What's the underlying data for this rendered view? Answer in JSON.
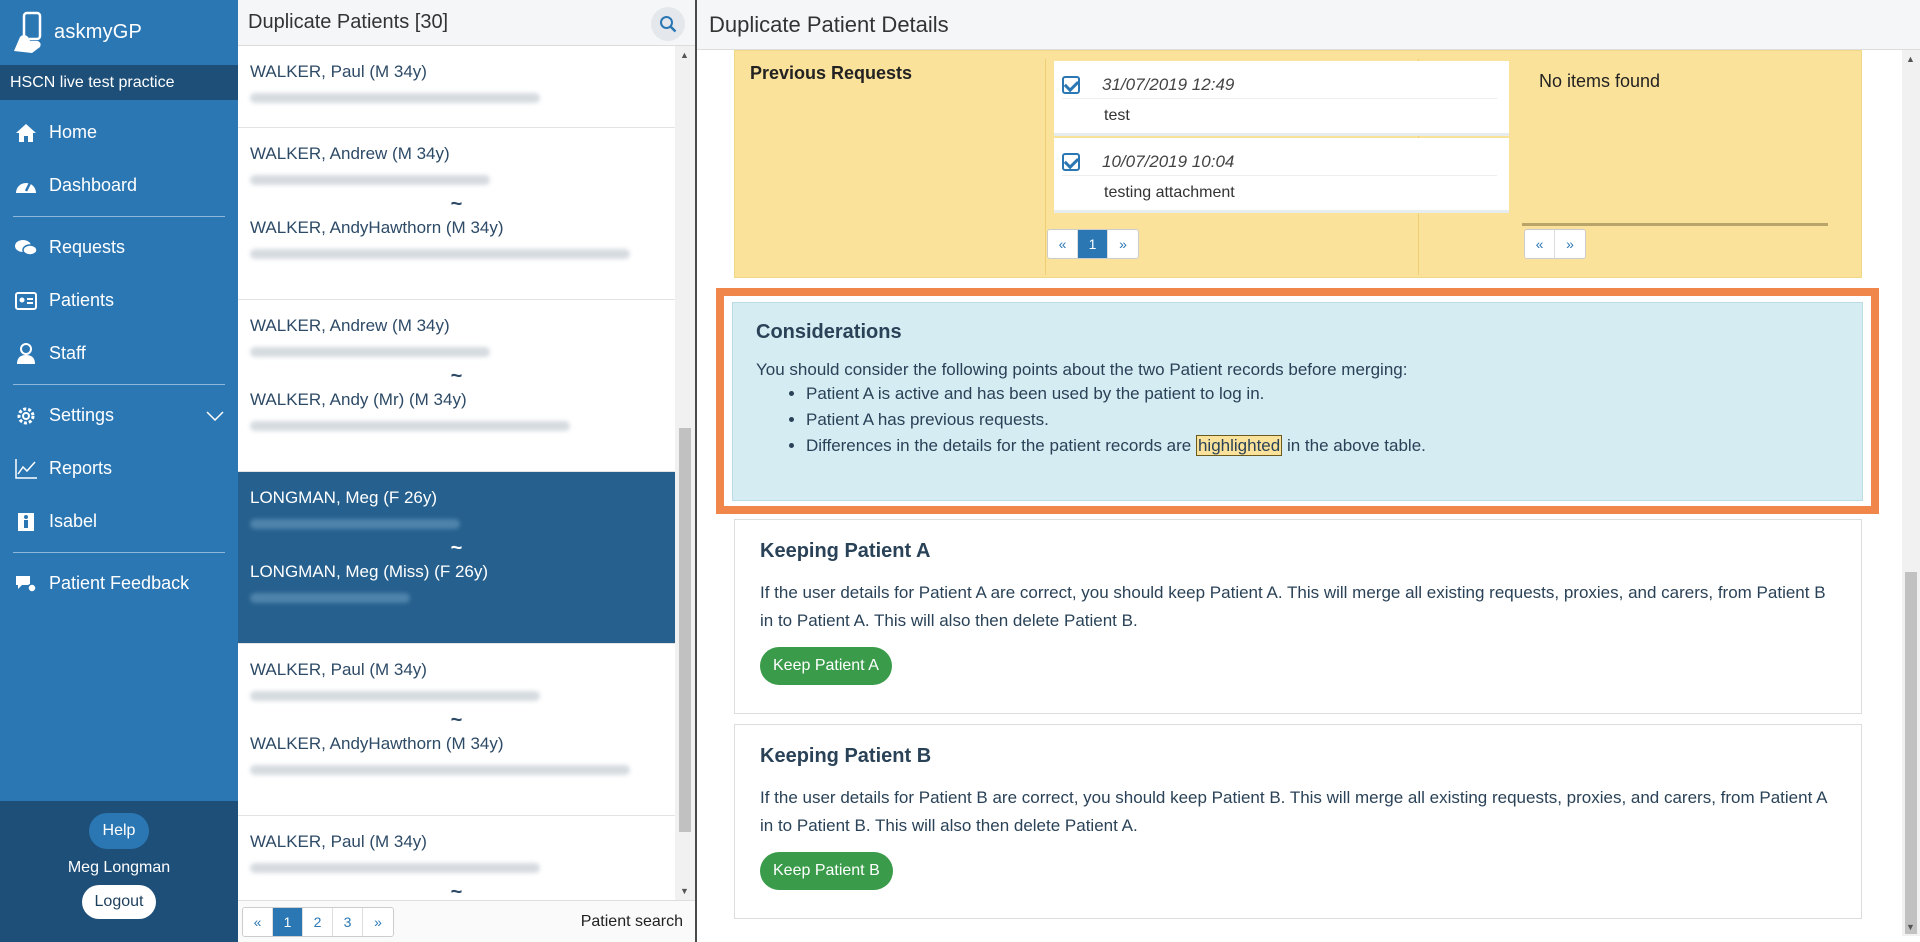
{
  "app": {
    "name": "askmyGP",
    "practice": "HSCN live test practice"
  },
  "nav": [
    {
      "label": "Home",
      "icon": "home-icon"
    },
    {
      "label": "Dashboard",
      "icon": "dashboard-icon"
    },
    {
      "label": "Requests",
      "icon": "chat-icon"
    },
    {
      "label": "Patients",
      "icon": "id-card-icon"
    },
    {
      "label": "Staff",
      "icon": "staff-icon"
    },
    {
      "label": "Settings",
      "icon": "gear-icon"
    },
    {
      "label": "Reports",
      "icon": "chart-icon"
    },
    {
      "label": "Isabel",
      "icon": "info-icon"
    },
    {
      "label": "Patient Feedback",
      "icon": "feedback-icon"
    }
  ],
  "sidebar_footer": {
    "help": "Help",
    "user": "Meg Longman",
    "logout": "Logout"
  },
  "list": {
    "title": "Duplicate Patients [30]",
    "items": [
      {
        "a": "WALKER, Paul (M 34y)"
      },
      {
        "a": "WALKER, Andrew (M 34y)",
        "b": "WALKER, AndyHawthorn (M 34y)"
      },
      {
        "a": "WALKER, Andrew (M 34y)",
        "b": "WALKER, Andy (Mr) (M 34y)"
      },
      {
        "a": "LONGMAN, Meg (F 26y)",
        "b": "LONGMAN, Meg (Miss) (F 26y)"
      },
      {
        "a": "WALKER, Paul (M 34y)",
        "b": "WALKER, AndyHawthorn (M 34y)"
      },
      {
        "a": "WALKER, Paul (M 34y)"
      }
    ],
    "tilde": "~",
    "pagination": [
      "«",
      "1",
      "2",
      "3",
      "»"
    ],
    "patient_search": "Patient search"
  },
  "details": {
    "title": "Duplicate Patient Details",
    "previous_requests": {
      "label": "Previous Requests",
      "items": [
        {
          "date": "31/07/2019 12:49",
          "text": "test"
        },
        {
          "date": "10/07/2019 10:04",
          "text": "testing attachment"
        }
      ],
      "pagination_a": [
        "«",
        "1",
        "»"
      ],
      "no_items": "No items found",
      "pagination_b": [
        "«",
        "»"
      ]
    },
    "considerations": {
      "title": "Considerations",
      "intro": "You should consider the following points about the two Patient records before merging:",
      "points": [
        "Patient A is active and has been used by the patient to log in.",
        "Patient A has previous requests."
      ],
      "diff_before": "Differences in the details for the patient records are ",
      "diff_highlight": "highlighted",
      "diff_after": " in the above table."
    },
    "keep_a": {
      "title": "Keeping Patient A",
      "text": "If the user details for Patient A are correct, you should keep Patient A. This will merge all existing requests, proxies, and carers, from Patient B in to Patient A. This will also then delete Patient B.",
      "button": "Keep Patient A"
    },
    "keep_b": {
      "title": "Keeping Patient B",
      "text": "If the user details for Patient B are correct, you should keep Patient B. This will merge all existing requests, proxies, and carers, from Patient A in to Patient B. This will also then delete Patient A.",
      "button": "Keep Patient B"
    }
  },
  "colors": {
    "sidebar": "#2b77b4",
    "sidebar_dark": "#1d4f79",
    "selected": "#26608e",
    "yellow": "#fbe29b",
    "blue_panel": "#d4ecf2",
    "orange": "#f0864a",
    "green": "#3a9c4a"
  }
}
